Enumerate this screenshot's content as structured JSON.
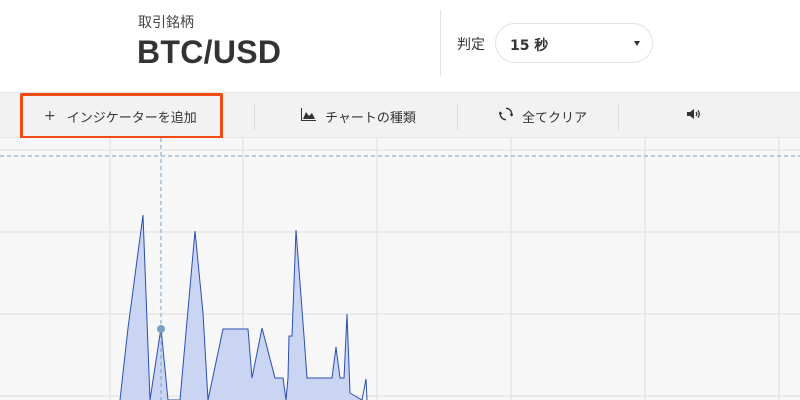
{
  "header": {
    "pair_label": "取引銘柄",
    "pair_value": "BTC/USD",
    "judge_label": "判定",
    "expiry_select": {
      "selected": "15 秒"
    }
  },
  "toolbar": {
    "add_indicator_label": "インジケーターを追加",
    "add_indicator_icon": "plus-icon",
    "chart_type_label": "チャートの種類",
    "chart_type_icon": "area-chart-icon",
    "clear_all_label": "全てクリア",
    "clear_all_icon": "refresh-icon",
    "sound_icon": "speaker-icon",
    "highlight_color": "#f04a15"
  },
  "chart": {
    "fill_color": "#c9d5f2",
    "line_color": "#2a4fb0",
    "grid_color": "#dddddd",
    "crosshair_color": "#7aa0c8"
  }
}
